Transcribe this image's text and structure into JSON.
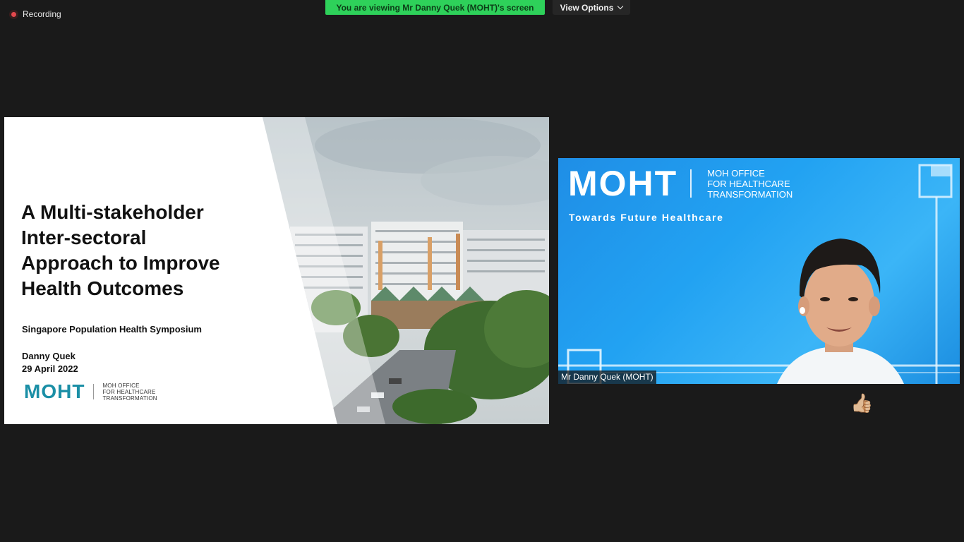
{
  "recording": {
    "label": "Recording"
  },
  "banner": {
    "viewing_text": "You are viewing Mr Danny Quek (MOHT)'s screen",
    "view_options_label": "View Options"
  },
  "slide": {
    "title_lines": [
      "A Multi-stakeholder",
      "Inter-sectoral",
      "Approach to Improve",
      "Health Outcomes"
    ],
    "event": "Singapore Population Health Symposium",
    "author": "Danny Quek",
    "date": "29 April 2022",
    "logo_word": "MOHT",
    "logo_sub": [
      "MOH OFFICE",
      "FOR HEALTHCARE",
      "TRANSFORMATION"
    ]
  },
  "video": {
    "logo_word": "MOHT",
    "logo_sub": [
      "MOH OFFICE",
      "FOR HEALTHCARE",
      "TRANSFORMATION"
    ],
    "tagline": "Towards Future Healthcare",
    "participant_name": "Mr Danny Quek (MOHT)"
  },
  "reaction": {
    "emoji": "👍🏼"
  },
  "colors": {
    "background": "#1a1a1a",
    "banner_green": "#2ed15a",
    "moht_teal": "#1b8fa6",
    "video_blue": "#22a2f2",
    "recording_red": "#e5484d"
  }
}
